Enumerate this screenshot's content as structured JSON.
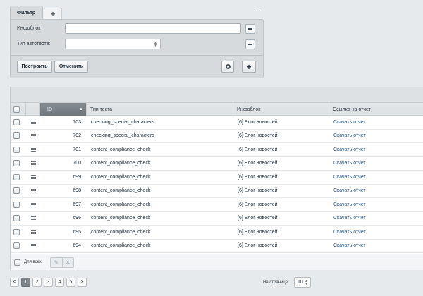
{
  "filter": {
    "tab_label": "Фильтр",
    "add_tab_label": "+",
    "fields": [
      {
        "label": "Инфоблок",
        "value": ""
      },
      {
        "label": "Тип автотеста:",
        "value": ""
      }
    ],
    "find_label": "Построить",
    "cancel_label": "Отменить",
    "plus_label": "+"
  },
  "grid": {
    "columns": {
      "id": "ID",
      "type": "Тип теста",
      "iblock": "Инфоблок",
      "link": "Ссылка на отчет"
    },
    "rows": [
      {
        "id": "703",
        "type": "checking_special_characters",
        "iblock": "[6] Блог новостей",
        "link": "Скачать отчет"
      },
      {
        "id": "702",
        "type": "checking_special_characters",
        "iblock": "[6] Блог новостей",
        "link": "Скачать отчет"
      },
      {
        "id": "701",
        "type": "content_compliance_check",
        "iblock": "[6] Блог новостей",
        "link": "Скачать отчет"
      },
      {
        "id": "700",
        "type": "content_compliance_check",
        "iblock": "[6] Блог новостей",
        "link": "Скачать отчет"
      },
      {
        "id": "699",
        "type": "content_compliance_check",
        "iblock": "[6] Блог новостей",
        "link": "Скачать отчет"
      },
      {
        "id": "698",
        "type": "content_compliance_check",
        "iblock": "[6] Блог новостей",
        "link": "Скачать отчет"
      },
      {
        "id": "697",
        "type": "content_compliance_check",
        "iblock": "[6] Блог новостей",
        "link": "Скачать отчет"
      },
      {
        "id": "696",
        "type": "content_compliance_check",
        "iblock": "[6] Блог новостей",
        "link": "Скачать отчет"
      },
      {
        "id": "695",
        "type": "content_compliance_check",
        "iblock": "[6] Блог новостей",
        "link": "Скачать отчет"
      },
      {
        "id": "694",
        "type": "content_compliance_check",
        "iblock": "[6] Блог новостей",
        "link": "Скачать отчет"
      }
    ],
    "for_all_label": "Для всех"
  },
  "pager": {
    "pages": [
      "1",
      "2",
      "3",
      "4",
      "5"
    ],
    "active_page": "1",
    "prev": "<",
    "next": ">",
    "per_page_label": "На странице:",
    "per_page_value": "10"
  },
  "icons": {
    "tab_collapse": "minus-icon",
    "field_remove": "minus-icon",
    "settings": "gear-icon",
    "row_menu": "hamburger-icon",
    "edit": "pencil-icon",
    "delete": "cross-icon",
    "sort": "sort-asc-icon"
  }
}
